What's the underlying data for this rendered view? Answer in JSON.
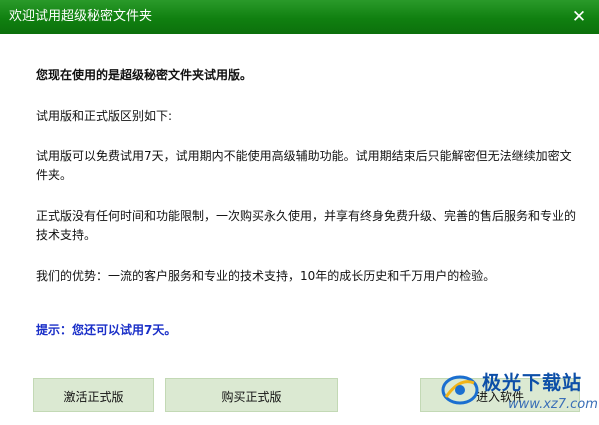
{
  "window": {
    "title": "欢迎试用超级秘密文件夹",
    "close_glyph": "✕"
  },
  "body": {
    "heading": "您现在使用的是超级秘密文件夹试用版。",
    "intro": "试用版和正式版区别如下:",
    "trial_desc": "试用版可以免费试用7天，试用期内不能使用高级辅助功能。试用期结束后只能解密但无法继续加密文件夹。",
    "full_desc": "正式版没有任何时间和功能限制，一次购买永久使用，并享有终身免费升级、完善的售后服务和专业的技术支持。",
    "advantages": "我们的优势：一流的客户服务和专业的技术支持，10年的成长历史和千万用户的检验。",
    "tip": "提示：您还可以试用7天。"
  },
  "buttons": {
    "activate": "激活正式版",
    "buy": "购买正式版",
    "enter": "进入软件"
  },
  "watermark": {
    "text": "极光下载站",
    "url": "www.xz7.com"
  }
}
